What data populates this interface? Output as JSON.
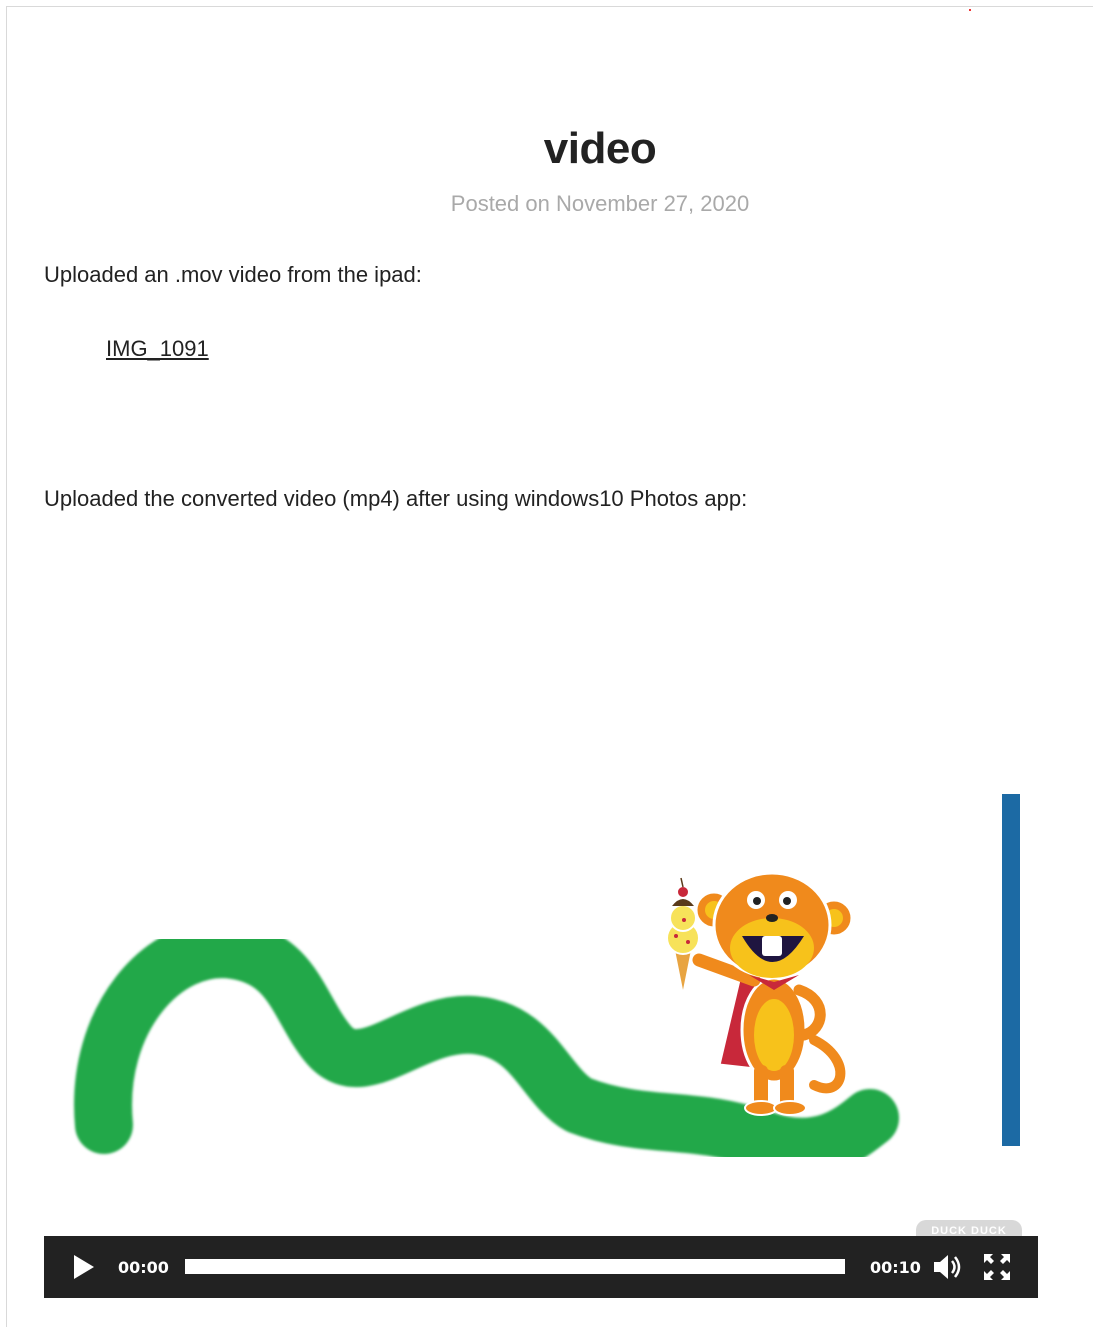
{
  "post": {
    "title": "video",
    "meta_prefix": "Posted on ",
    "meta_date": "November 27, 2020",
    "paragraph_1": "Uploaded an .mov video from the ipad:",
    "attachment_link": "IMG_1091",
    "paragraph_2": "Uploaded the converted video (mp4) after using windows10 Photos app:"
  },
  "video": {
    "badge_text": "DUCK DUCK",
    "current_time": "00:00",
    "duration": "00:10",
    "progress_fraction": 0,
    "colors": {
      "green_stroke": "#22a84a",
      "blue_stroke": "#1a6aa4",
      "controls_bg": "#222222",
      "monkey_orange": "#f08a1c",
      "monkey_cape": "#c8283a"
    },
    "icons": {
      "play": "play-icon",
      "volume": "volume-icon",
      "fullscreen": "fullscreen-icon"
    }
  }
}
